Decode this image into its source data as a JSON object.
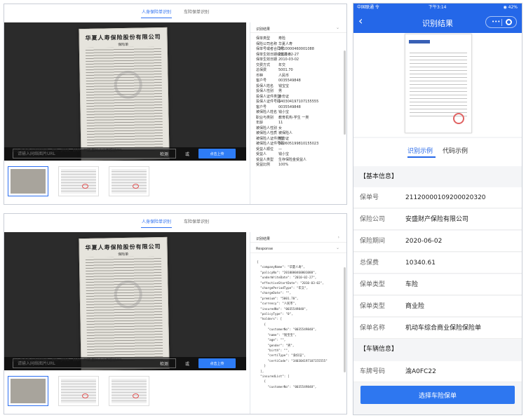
{
  "top_panel": {
    "tab_active": "人身保险单识别",
    "tab_inactive": "车险保单识别",
    "url_placeholder": "请输入网络图片URL",
    "detect_label": "检测",
    "or_label": "或",
    "upload_label": "点击上传",
    "hint": "图片文件类型支持PNG、JPG、JPEG、BMP、PDF,图片大小不超过2M。",
    "doc_title": "华夏人寿保险股份有限公司",
    "doc_subtitle": "保险单",
    "result_title": "识别结果",
    "fields": [
      {
        "k": "保单类型",
        "v": "寿险"
      },
      {
        "k": "保险公司名称",
        "v": "华夏人寿"
      },
      {
        "k": "保单号或者合同号",
        "v": "2010000460001088"
      },
      {
        "k": "保单生效日期或签发日",
        "v": "2010-02-27"
      },
      {
        "k": "保单生效日期",
        "v": "2010-03-02"
      },
      {
        "k": "交费方式",
        "v": "年交"
      },
      {
        "k": "总保费",
        "v": "5001.70"
      },
      {
        "k": "币种",
        "v": "人民币"
      },
      {
        "k": "客户号",
        "v": "0035549848"
      },
      {
        "k": "投保人姓名",
        "v": "钱宝宝"
      },
      {
        "k": "投保人性别",
        "v": "男"
      },
      {
        "k": "投保人证件类型",
        "v": "身份证"
      },
      {
        "k": "投保人证件号码",
        "v": "340304197107155555"
      },
      {
        "k": "客户号",
        "v": "0035549848"
      },
      {
        "k": "被保险人姓名",
        "v": "钱小宝"
      },
      {
        "k": "职业与类别",
        "v": "教育机构-学生 一类"
      },
      {
        "k": "年龄",
        "v": "11"
      },
      {
        "k": "被保险人性别",
        "v": "女"
      },
      {
        "k": "被保险人性质",
        "v": "被保险人"
      },
      {
        "k": "被保险人证件类型",
        "v": "身份证"
      },
      {
        "k": "被保险人证件号码",
        "v": "320605199810155023"
      },
      {
        "k": "受益人顺位",
        "v": "—"
      },
      {
        "k": "受益人",
        "v": "钱小宝"
      },
      {
        "k": "受益人类型",
        "v": "生存保险金受益人"
      },
      {
        "k": "受益比例",
        "v": "100%"
      }
    ]
  },
  "bottom_panel": {
    "tab_active": "人身保险单识别",
    "tab_inactive": "车险保单识别",
    "url_placeholder": "请输入网络图片URL",
    "detect_label": "检测",
    "or_label": "或",
    "upload_label": "点击上传",
    "hint": "图片文件类型支持PNG、JPG、JPEG、BMP、PDF,图片大小不超过2M。",
    "doc_title": "华夏人寿保险股份有限公司",
    "doc_subtitle": "保险单",
    "result_title": "识别结果",
    "response_title": "Response",
    "json_lines": [
      "{",
      "  \"companyName\": \"华夏人寿\",",
      "  \"policyNo\": \"2010000460001088\",",
      "  \"underWriteDate\": \"2010-02-27\",",
      "  \"effectiveStartDate\": \"2010-03-02\",",
      "  \"chargePeriodType\": \"年交\",",
      "  \"chargeDate\": \"\",",
      "  \"premium\": \"5001.70\",",
      "  \"currency\": \"人民币\",",
      "  \"insuredNo\": \"0035549848\",",
      "  \"policyType\": \"0\",",
      "  \"holders\": [",
      "    {",
      "      \"customerNo\": \"0035549848\",",
      "      \"name\": \"钱宝宝\",",
      "      \"age\": \"\",",
      "      \"gender\": \"男\",",
      "      \"birth\": \"\",",
      "      \"certiType\": \"身份证\",",
      "      \"certiCode\": \"340304197107155555\"",
      "    }",
      "  ],",
      "  \"insuredList\": [",
      "    {",
      "      \"customerNo\": \"0035549848\","
    ]
  },
  "phone": {
    "status_left": "中国联通 令",
    "status_time": "下午3:14",
    "status_right": "◉ 42%",
    "back_icon": "‹",
    "title": "识别结果",
    "capsule_dots": "•••",
    "tab_a": "识别示例",
    "tab_b": "代码示例",
    "section_basic": "【基本信息】",
    "rows": [
      {
        "k": "保单号",
        "v": "21120000109200020320"
      },
      {
        "k": "保险公司",
        "v": "安盛财产保险有限公司"
      },
      {
        "k": "保险期间",
        "v": "2020-06-02"
      },
      {
        "k": "总保费",
        "v": "10340.61"
      },
      {
        "k": "保单类型",
        "v": "车险"
      },
      {
        "k": "保单类型",
        "v": "商业险"
      },
      {
        "k": "保单名称",
        "v": "机动车综合商业保险保险单"
      }
    ],
    "section_vehicle": "【车辆信息】",
    "vehicle_rows": [
      {
        "k": "车牌号码",
        "v": "渝A0FC22"
      }
    ],
    "select_button": "选择车险保单"
  }
}
